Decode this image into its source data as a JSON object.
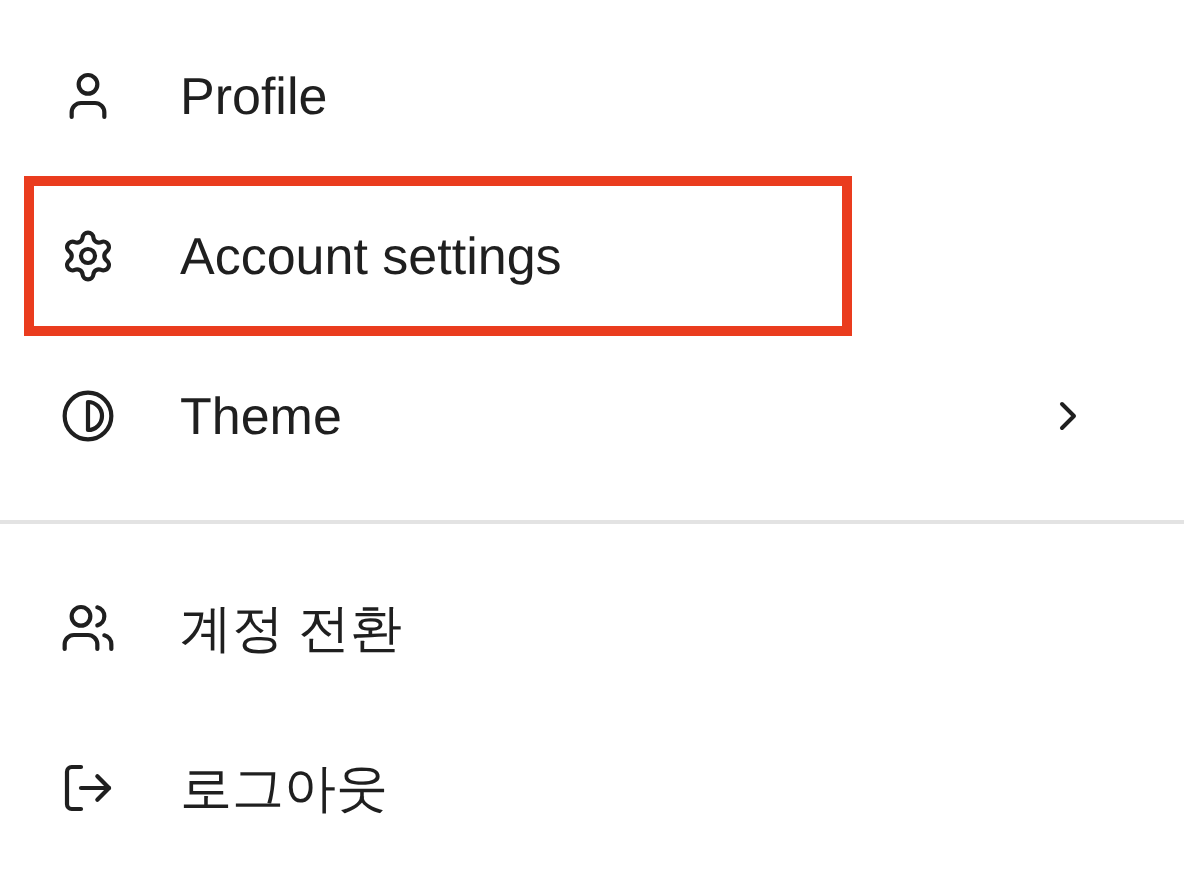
{
  "menu": {
    "groups": [
      {
        "items": [
          {
            "label": "Profile",
            "highlighted": false,
            "submenu": false
          },
          {
            "label": "Account settings",
            "highlighted": true,
            "submenu": false
          },
          {
            "label": "Theme",
            "highlighted": false,
            "submenu": true
          }
        ]
      },
      {
        "items": [
          {
            "label": "계정 전환",
            "highlighted": false,
            "submenu": false
          },
          {
            "label": "로그아웃",
            "highlighted": false,
            "submenu": false
          }
        ]
      }
    ]
  }
}
